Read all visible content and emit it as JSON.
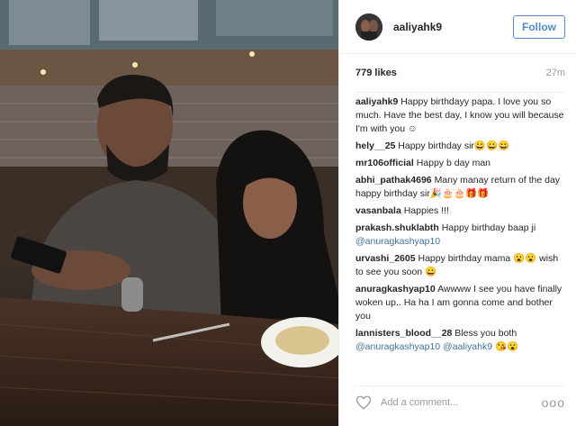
{
  "post": {
    "username": "aaliyahk9",
    "follow_label": "Follow",
    "likes": "779 likes",
    "time_ago": "27m"
  },
  "comments": [
    {
      "user": "aaliyahk9",
      "text": "Happy birthdayy papa. I love you so much. Have the best day, I know you will because I'm with you ☺"
    },
    {
      "user": "hely__25",
      "text": "Happy birthday sir😀😀😀"
    },
    {
      "user": "mr106official",
      "text": "Happy b day man"
    },
    {
      "user": "abhi_pathak4696",
      "text": "Many manay return of the day happy birthday sir🎉🎂🎂🎁🎁"
    },
    {
      "user": "vasanbala",
      "text": "Happies !!!"
    },
    {
      "user": "prakash.shuklabth",
      "text": "Happy birthday baap ji",
      "mention": "@anuragkashyap10"
    },
    {
      "user": "urvashi_2605",
      "text": "Happy birthday mama 😮😮 wish to see you soon 😀"
    },
    {
      "user": "anuragkashyap10",
      "text": "Awwww I see you have finally woken up.. Ha ha I am gonna come and bother you"
    },
    {
      "user": "lannisters_blood__28",
      "text": "Bless you both",
      "mention": "@anuragkashyap10 @aaliyahk9",
      "suffix": " 😘😮"
    }
  ],
  "footer": {
    "add_comment_placeholder": "Add a comment...",
    "more": "ooo"
  },
  "icons": {
    "like": "heart-icon",
    "more": "more-options-icon"
  },
  "colors": {
    "follow_blue": "#4f8cc9",
    "mention_blue": "#3f729b",
    "muted": "#999999"
  }
}
